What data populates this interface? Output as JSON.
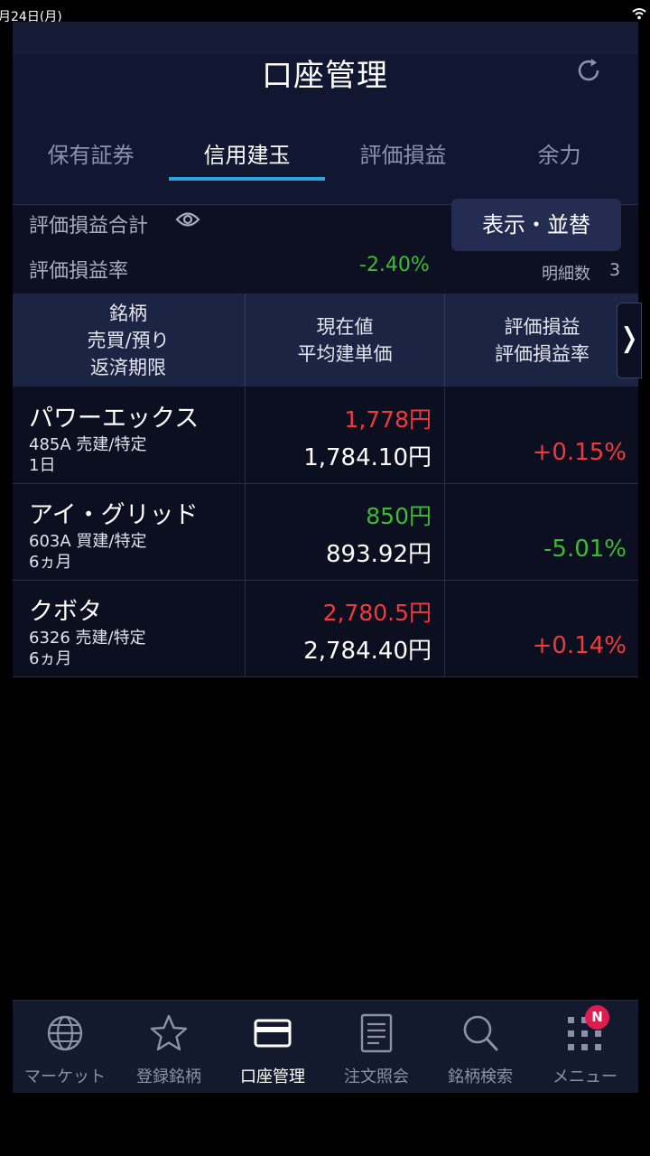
{
  "status_bar": {
    "date": "月24日(月)"
  },
  "header": {
    "title": "口座管理",
    "tabs": [
      {
        "label": "保有証券",
        "active": false
      },
      {
        "label": "信用建玉",
        "active": true
      },
      {
        "label": "評価損益",
        "active": false
      },
      {
        "label": "余力",
        "active": false
      }
    ]
  },
  "summary": {
    "total_label": "評価損益合計",
    "rate_label": "評価損益率",
    "rate_value": "-2.40%",
    "sort_button": "表示・並替",
    "count_label": "明細数",
    "count_value": "3"
  },
  "table": {
    "headers": {
      "col1": [
        "銘柄",
        "売買/預り",
        "返済期限"
      ],
      "col2": [
        "現在値",
        "平均建単価"
      ],
      "col3": [
        "評価損益",
        "評価損益率"
      ]
    },
    "rows": [
      {
        "name": "パワーエックス",
        "code_type": "485A 売建/特定",
        "term": "1日",
        "price": "1,778円",
        "avg_price": "1,784.10円",
        "pct": "+0.15%"
      },
      {
        "name": "アイ・グリッド",
        "code_type": "603A 買建/特定",
        "term": "6ヵ月",
        "price": "850円",
        "avg_price": "893.92円",
        "pct": "-5.01%"
      },
      {
        "name": "クボタ",
        "code_type": "6326 売建/特定",
        "term": "6ヵ月",
        "price": "2,780.5円",
        "avg_price": "2,784.40円",
        "pct": "+0.14%"
      }
    ]
  },
  "bottom_nav": {
    "items": [
      {
        "label": "マーケット",
        "icon": "globe-icon"
      },
      {
        "label": "登録銘柄",
        "icon": "star-icon"
      },
      {
        "label": "口座管理",
        "icon": "card-icon",
        "active": true
      },
      {
        "label": "注文照会",
        "icon": "document-icon"
      },
      {
        "label": "銘柄検索",
        "icon": "search-icon"
      },
      {
        "label": "メニュー",
        "icon": "grid-icon"
      }
    ],
    "menu_badge": "N"
  },
  "colors": {
    "gain": "#3dbb34",
    "loss": "#ef3b3b",
    "accent": "#2aa6e0"
  }
}
